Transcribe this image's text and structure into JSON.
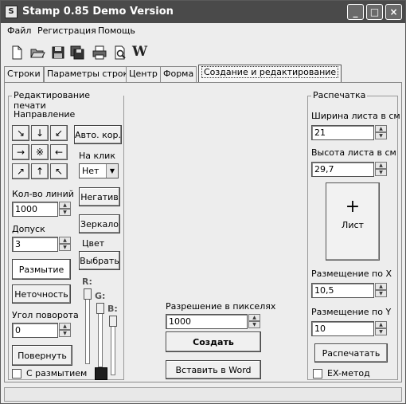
{
  "window": {
    "title": "Stamp 0.85 Demo Version",
    "controls": {
      "minimize": "_",
      "maximize": "□",
      "close": "×"
    }
  },
  "menu": {
    "file": "Файл",
    "registration": "Регистрация",
    "help": "Помощь"
  },
  "toolbar": {
    "icons": [
      "new-file-icon",
      "open-folder-icon",
      "save-icon",
      "save-all-icon",
      "print-icon",
      "print-preview-icon",
      "word-icon"
    ],
    "word_glyph": "W"
  },
  "tabs": [
    "Строки",
    "Параметры строк",
    "Центр",
    "Форма",
    "Создание и редактирование"
  ],
  "active_tab": 4,
  "edit_panel": {
    "title": "Редактирование печати",
    "direction_label": "Направление",
    "direction_arrows": [
      "↘",
      "↓",
      "↙",
      "→",
      "※",
      "←",
      "↗",
      "↑",
      "↖"
    ],
    "auto_button": "Авто. кор.",
    "on_click_label": "На клик",
    "on_click_value": "Нет",
    "lines_label": "Кол-во линий",
    "lines_value": "1000",
    "negative_button": "Негатив",
    "tolerance_label": "Допуск",
    "tolerance_value": "3",
    "mirror_button": "Зеркало",
    "color_label": "Цвет",
    "blur_button": "Размытие",
    "choose_button": "Выбрать",
    "inaccuracy_button": "Неточность",
    "r_label": "R:",
    "g_label": "G:",
    "b_label": "B:",
    "angle_label": "Угол поворота",
    "angle_value": "0",
    "rotate_button": "Повернуть",
    "with_blur_label": "С размытием",
    "swatch_color": "#1e1e1e"
  },
  "center_panel": {
    "resolution_label": "Разрешение в пикселях",
    "resolution_value": "1000",
    "create_button": "Создать",
    "insert_word_button": "Вставить в Word"
  },
  "print_panel": {
    "title": "Распечатка",
    "width_label": "Ширина листа в см",
    "width_value": "21",
    "height_label": "Высота листа в см",
    "height_value": "29,7",
    "sheet_label": "Лист",
    "pos_x_label": "Размещение по X",
    "pos_x_value": "10,5",
    "pos_y_label": "Размещение по Y",
    "pos_y_value": "10",
    "print_button": "Распечатать",
    "ex_method_label": "EX-метод"
  }
}
